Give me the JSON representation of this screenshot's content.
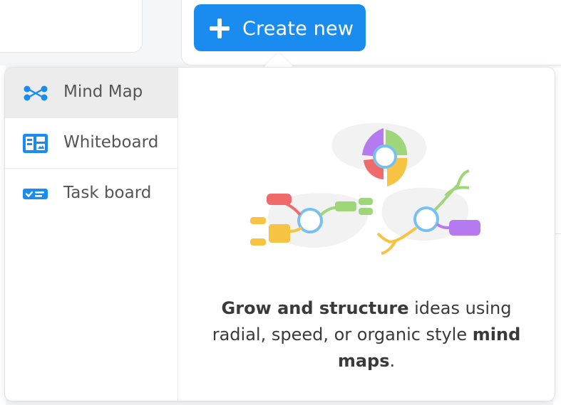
{
  "header": {
    "create_button_label": "Create new"
  },
  "menu": {
    "items": [
      {
        "label": "Mind Map",
        "icon": "mind-map-icon",
        "active": true
      },
      {
        "label": "Whiteboard",
        "icon": "whiteboard-icon",
        "active": false
      },
      {
        "label": "Task board",
        "icon": "task-board-icon",
        "active": false
      }
    ]
  },
  "preview": {
    "description_bold_1": "Grow and structure",
    "description_text_1": " ideas using radial, speed, or organic style ",
    "description_bold_2": "mind maps",
    "description_text_2": "."
  },
  "colors": {
    "accent": "#1a8cf0",
    "purple": "#b57af0",
    "green": "#9fd67a",
    "red": "#ef6b6b",
    "yellow": "#f6c343",
    "ring": "#79c0f2"
  }
}
